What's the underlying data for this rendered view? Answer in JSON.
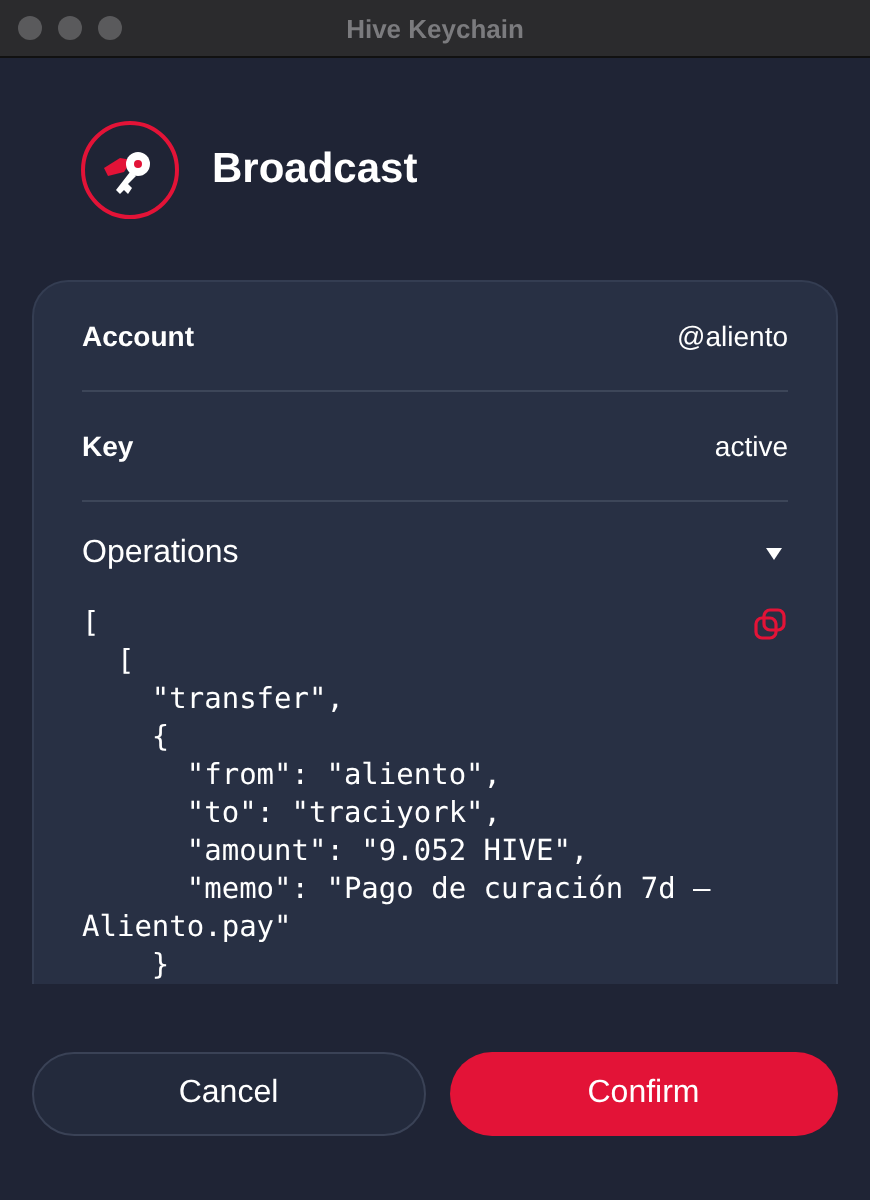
{
  "window": {
    "title": "Hive Keychain"
  },
  "header": {
    "title": "Broadcast"
  },
  "fields": [
    {
      "label": "Account",
      "value": "@aliento"
    },
    {
      "label": "Key",
      "value": "active"
    }
  ],
  "operations": {
    "label": "Operations",
    "expanded": true,
    "code_lines": [
      "[",
      "  [",
      "    \"transfer\",",
      "    {",
      "      \"from\": \"aliento\",",
      "      \"to\": \"traciyork\",",
      "      \"amount\": \"9.052 HIVE\",",
      "      \"memo\": \"Pago de curación 7d –",
      "Aliento.pay\"",
      "    }"
    ]
  },
  "buttons": [
    {
      "label": "Cancel",
      "kind": "secondary"
    },
    {
      "label": "Confirm",
      "kind": "primary"
    }
  ]
}
